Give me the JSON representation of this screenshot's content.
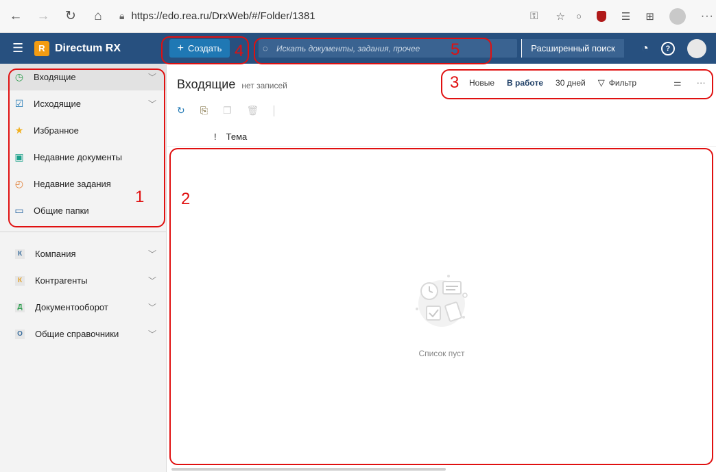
{
  "browser": {
    "url": "https://edo.rea.ru/DrxWeb/#/Folder/1381"
  },
  "header": {
    "brand": "Directum RX",
    "create_label": "Создать",
    "search_placeholder": "Искать документы, задания, прочее",
    "advanced_search": "Расширенный поиск"
  },
  "sidebar": {
    "items": [
      {
        "label": "Входящие"
      },
      {
        "label": "Исходящие"
      },
      {
        "label": "Избранное"
      },
      {
        "label": "Недавние документы"
      },
      {
        "label": "Недавние задания"
      },
      {
        "label": "Общие папки"
      }
    ],
    "groups": [
      {
        "letter": "К",
        "label": "Компания"
      },
      {
        "letter": "К",
        "label": "Контрагенты"
      },
      {
        "letter": "Д",
        "label": "Документооборот"
      },
      {
        "letter": "О",
        "label": "Общие справочники"
      }
    ]
  },
  "main": {
    "title": "Входящие",
    "subtitle": "нет записей",
    "filters": {
      "new": "Новые",
      "in_work": "В работе",
      "days": "30 дней",
      "filter": "Фильтр"
    },
    "columns": {
      "importance": "!",
      "subject": "Тема"
    },
    "empty_text": "Список пуст"
  },
  "annotations": [
    "1",
    "2",
    "3",
    "4",
    "5"
  ],
  "colors": {
    "header_bg": "#27507f",
    "accent": "#1f78b4",
    "annotation": "#e01010"
  }
}
